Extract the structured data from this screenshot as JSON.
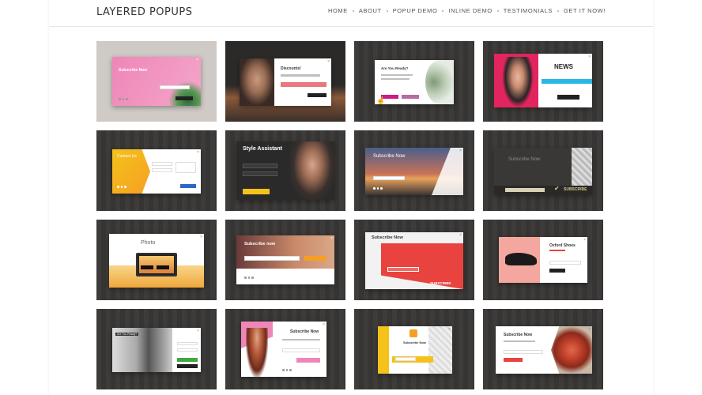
{
  "site": {
    "logo": "LAYERED POPUPS",
    "nav": [
      "HOME",
      "ABOUT",
      "POPUP DEMO",
      "INLINE DEMO",
      "TESTIMONIALS",
      "GET IT NOW!"
    ]
  },
  "tiles": {
    "t1": {
      "title": "Subscribe Now"
    },
    "t2": {
      "title": "Discounts!"
    },
    "t3": {
      "title": "Are You Ready?"
    },
    "t4": {
      "title": "NEWS"
    },
    "t5": {
      "title": "Contact Us"
    },
    "t6": {
      "title": "Style Assistant"
    },
    "t7": {
      "title": "Subscribe Now"
    },
    "t8": {
      "title": "Subscribe Now",
      "button": "SUBSCRIBE"
    },
    "t9": {
      "title": "Photo"
    },
    "t10": {
      "title": "Subscribe now"
    },
    "t11": {
      "title": "Subscribe Now",
      "button": "SUBSCRIBE"
    },
    "t12": {
      "title": "Oxford Shoes"
    },
    "t13": {
      "title": "Are You Ready?"
    },
    "t14": {
      "title": "Subscribe Now"
    },
    "t15": {
      "title": "Subscribe Now"
    },
    "t16": {
      "title": "Subscribe Now"
    }
  },
  "colors": {
    "pink": "#ef86b8",
    "magenta": "#cc1b86",
    "red": "#e8433e",
    "yellow": "#f5c21b",
    "orange": "#f5a023",
    "green": "#3fa845",
    "cyan": "#29b7e5",
    "blue": "#2d68c4",
    "tile_bg": "#3a3836"
  },
  "icons": [
    "close-icon",
    "checkmark-icon",
    "pointer-cursor-icon"
  ]
}
